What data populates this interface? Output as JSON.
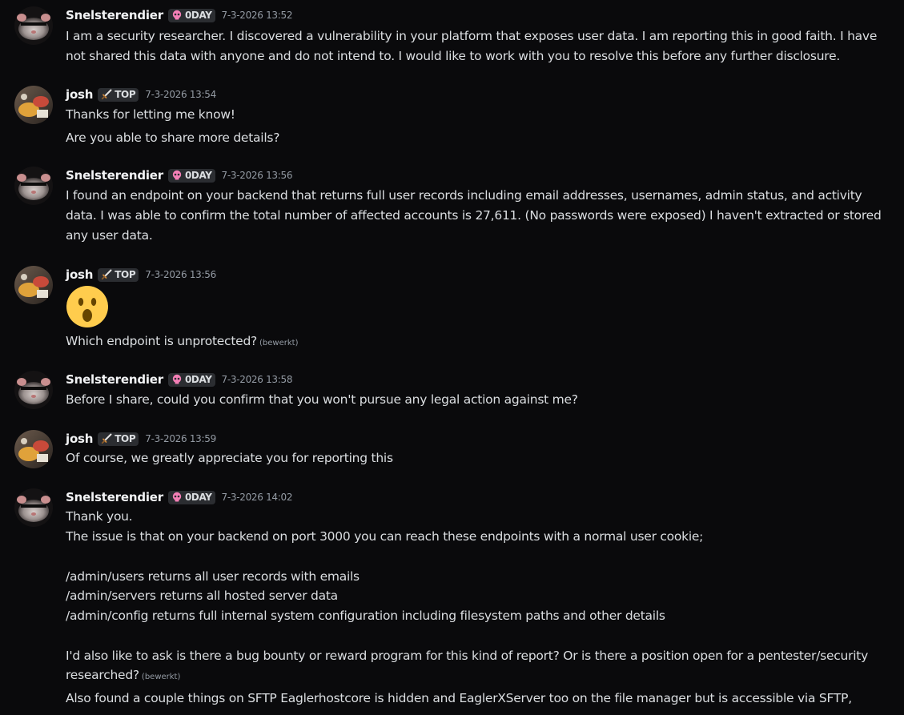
{
  "users": {
    "snel": {
      "name": "Snelsterendier",
      "tag": "0DAY"
    },
    "josh": {
      "name": "josh",
      "tag": "TOP"
    }
  },
  "edited_label": "(bewerkt)",
  "messages": [
    {
      "timestamp": "7-3-2026 13:52",
      "lines": [
        "I am a security researcher. I discovered a vulnerability in your platform that exposes user data. I am reporting this in good faith. I have",
        "not shared this data with anyone and do not intend to. I would like to work with you to resolve this before any further disclosure."
      ]
    },
    {
      "timestamp": "7-3-2026 13:54",
      "lines": [
        "Thanks for letting me know!",
        "Are you able to share more details?"
      ]
    },
    {
      "timestamp": "7-3-2026 13:56",
      "lines": [
        "I found an endpoint on your backend that returns full user records including email addresses, usernames, admin status, and activity",
        "data. I was able to confirm the total number of affected accounts is 27,611. (No passwords were exposed) I haven't extracted or stored",
        "any user data."
      ]
    },
    {
      "timestamp": "7-3-2026 13:56",
      "emoji": "hushed-face-emoji",
      "lines": [
        "Which endpoint is unprotected?"
      ]
    },
    {
      "timestamp": "7-3-2026 13:58",
      "lines": [
        "Before I share, could you confirm that you won't pursue any legal action against me?"
      ]
    },
    {
      "timestamp": "7-3-2026 13:59",
      "lines": [
        "Of course, we greatly appreciate you for reporting this"
      ]
    },
    {
      "timestamp": "7-3-2026 14:02",
      "lines": [
        "Thank you.",
        "The issue is that on your backend on port 3000 you can reach these endpoints with a normal user cookie;",
        "/admin/users  returns all user records with emails",
        "/admin/servers  returns all hosted server data",
        "/admin/config  returns full internal system configuration including filesystem paths and other details",
        "I'd also like to ask  is there a bug bounty or reward program for this kind of report? Or is there a position open for a pentester/security",
        "researched?",
        "Also found a couple things on SFTP Eaglerhostcore is hidden and EaglerXServer too on the file manager but is accessible via SFTP,"
      ]
    }
  ],
  "colors": {
    "background": "#0a0a0c",
    "text": "#dbdee1",
    "muted": "#949ba4",
    "tag_bg": "#2b2d31"
  }
}
